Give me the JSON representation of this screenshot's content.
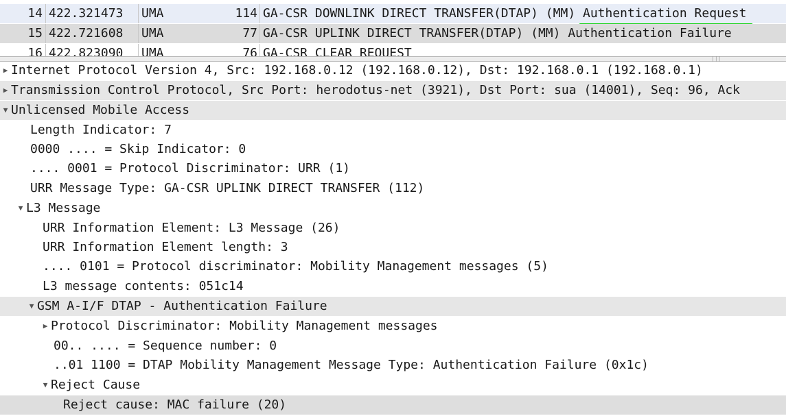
{
  "packet_list": {
    "rows": [
      {
        "no": "14",
        "time": "422.321473",
        "protocol": "UMA",
        "length": "114",
        "info_prefix": "GA-CSR DOWNLINK DIRECT TRANSFER(DTAP) (MM) ",
        "info_highlight": "Authentication Request"
      },
      {
        "no": "15",
        "time": "422.721608",
        "protocol": "UMA",
        "length": "77",
        "info_prefix": "GA-CSR UPLINK DIRECT TRANSFER(DTAP) (MM) ",
        "info_highlight": "Authentication Failure"
      },
      {
        "no": "16",
        "time": "422.823090",
        "protocol": "UMA",
        "length": "76",
        "info_prefix": "GA-CSR CLEAR REQUEST",
        "info_highlight": ""
      }
    ]
  },
  "details": {
    "ip": "Internet Protocol Version 4, Src: 192.168.0.12 (192.168.0.12), Dst: 192.168.0.1 (192.168.0.1)",
    "tcp": "Transmission Control Protocol, Src Port: herodotus-net (3921), Dst Port: sua (14001), Seq: 96, Ack",
    "uma": "Unlicensed Mobile Access",
    "length_indicator": "Length Indicator: 7",
    "skip_indicator": "0000 .... = Skip Indicator: 0",
    "protocol_discriminator": ".... 0001 = Protocol Discriminator: URR (1)",
    "urr_message_type": "URR Message Type: GA-CSR UPLINK DIRECT TRANSFER (112)",
    "l3_message": "L3 Message",
    "urr_ie": "URR Information Element: L3 Message (26)",
    "urr_ie_length": "URR Information Element length: 3",
    "l3_pd": ".... 0101 = Protocol discriminator: Mobility Management messages (5)",
    "l3_contents": "L3 message contents: 051c14",
    "gsm_dtap": "GSM A-I/F DTAP - Authentication Failure",
    "gsm_pd": "Protocol Discriminator: Mobility Management messages",
    "seq_number": "00.. .... = Sequence number: 0",
    "msg_type_prefix": "..01 1100 = DTAP Mobility Management Message Type: ",
    "msg_type_highlight": "Authentication Failure",
    "msg_type_suffix": " (0x1c)",
    "reject_cause_group": "Reject Cause",
    "reject_cause_prefix": "Reject cause: ",
    "reject_cause_highlight": "MAC failure (20)"
  },
  "colors": {
    "green_underline": "#1fd51f",
    "red_underline": "#e60000",
    "selected_row": "#dcdcdc"
  },
  "icons": {
    "collapsed": "triangle-right-icon",
    "expanded": "triangle-down-icon"
  }
}
